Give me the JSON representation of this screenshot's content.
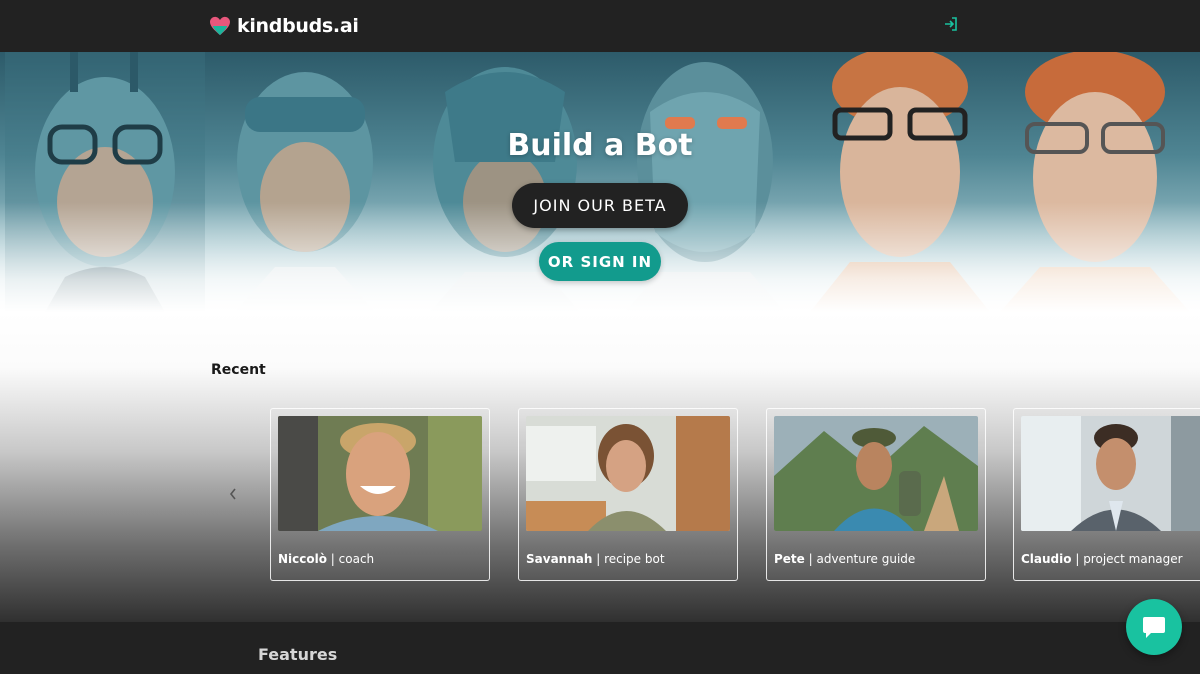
{
  "nav": {
    "brand": "kindbuds.ai",
    "logo_icon": "heart-logo-icon",
    "signin_icon": "sign-in-icon"
  },
  "hero": {
    "title": "Build a Bot",
    "join_button": "JOIN OUR BETA",
    "signin_button": "OR SIGN IN"
  },
  "recent": {
    "title": "Recent",
    "cards": [
      {
        "name": "Niccolò",
        "role": " | coach"
      },
      {
        "name": "Savannah",
        "role": " | recipe bot"
      },
      {
        "name": "Pete",
        "role": " | adventure guide"
      },
      {
        "name": "Claudio",
        "role": " | project manager"
      }
    ]
  },
  "features": {
    "title": "Features"
  },
  "colors": {
    "accent": "#129b8d",
    "chat": "#19c2a0",
    "dark": "#222222"
  }
}
